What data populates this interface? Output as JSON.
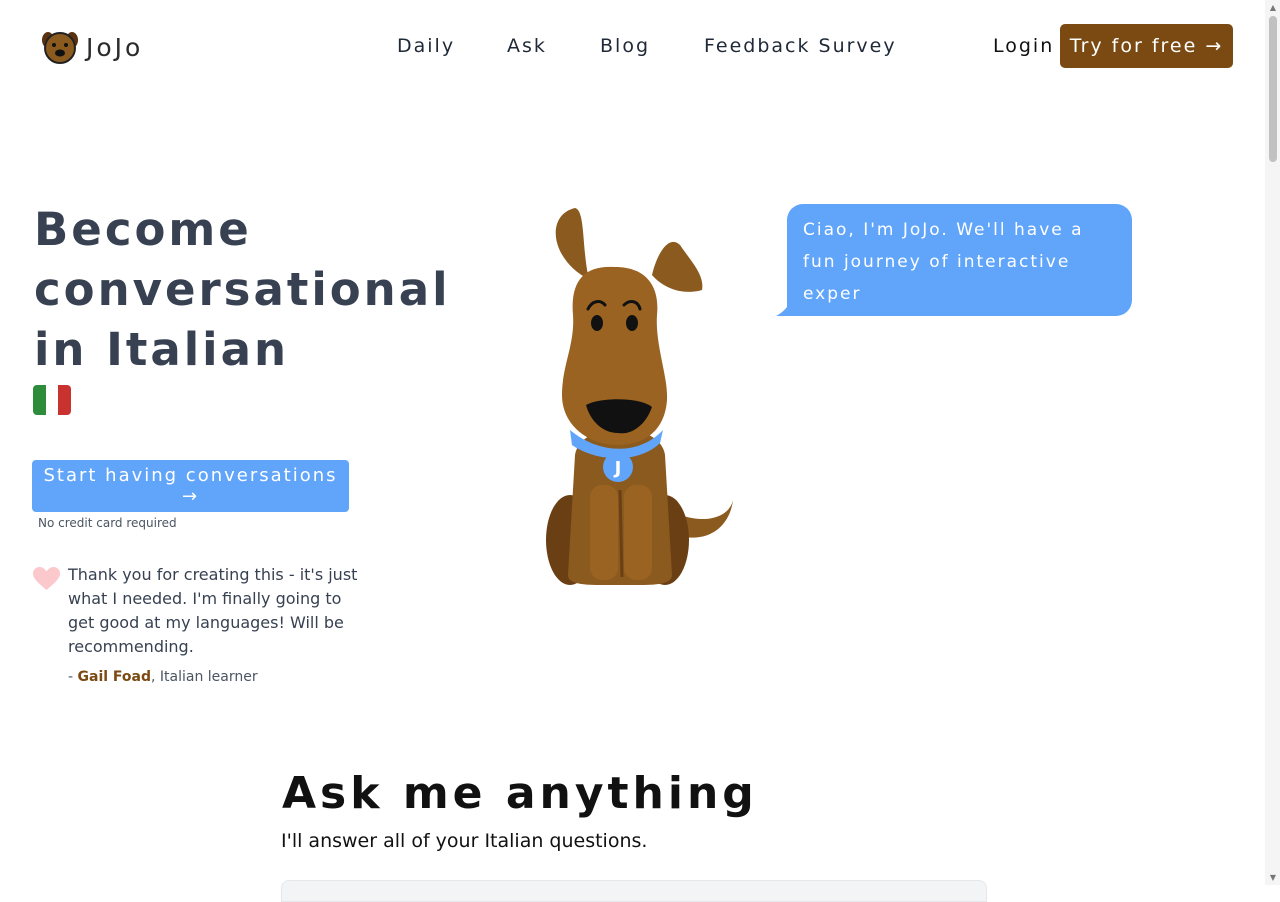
{
  "brand": {
    "name": "JoJo"
  },
  "nav": {
    "items": [
      {
        "label": "Daily"
      },
      {
        "label": "Ask"
      },
      {
        "label": "Blog"
      },
      {
        "label": "Feedback Survey"
      }
    ],
    "login": "Login",
    "try_free": "Try for free →"
  },
  "hero": {
    "title": "Become conversational in Italian",
    "flag_icon": "italy-flag-icon",
    "cta": "Start having conversations →",
    "cta_note": "No credit card required"
  },
  "testimonial": {
    "text": "Thank you for creating this - it's just what I needed. I'm finally going to get good at my languages! Will be recommending.",
    "prefix": "- ",
    "author": "Gail Foad",
    "role": ", Italian learner"
  },
  "bubble": {
    "text": "Ciao, I'm JoJo. We'll have a fun journey of interactive exper"
  },
  "dog": {
    "collar_letter": "J"
  },
  "ask": {
    "title": "Ask me anything",
    "subtitle": "I'll answer all of your Italian questions."
  },
  "colors": {
    "brand_brown": "#7a4a12",
    "accent_blue": "#60a5fa",
    "flag_green": "#2e8b3a",
    "flag_red": "#c8322f"
  }
}
